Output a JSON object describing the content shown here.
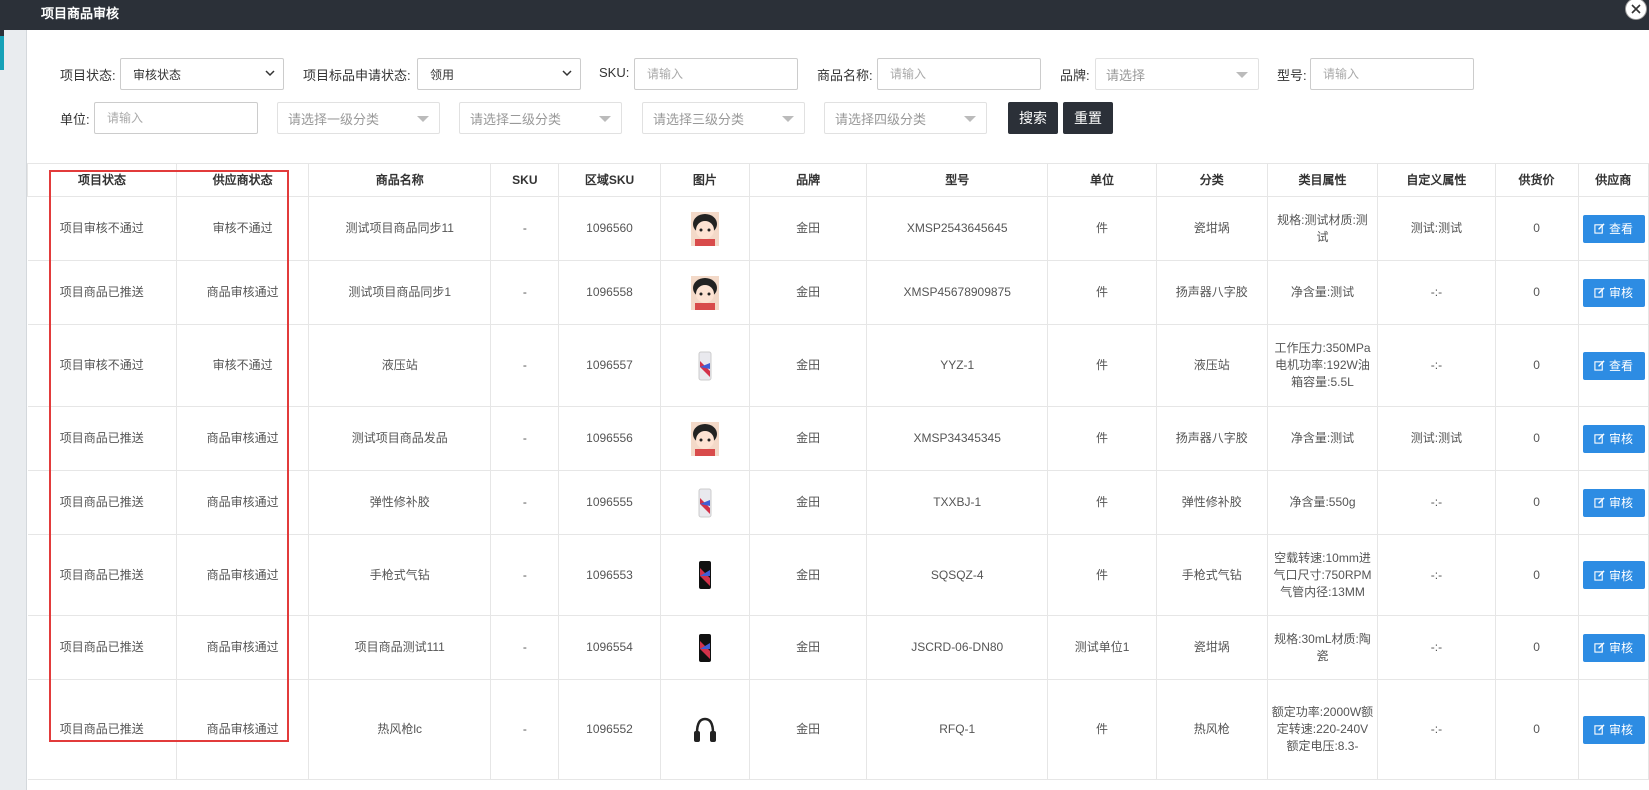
{
  "modal": {
    "title": "项目商品审核",
    "close_icon": "close-icon"
  },
  "filters": {
    "project_status": {
      "label": "项目状态:",
      "value": "审核状态"
    },
    "apply_status": {
      "label": "项目标品申请状态:",
      "value": "领用"
    },
    "sku": {
      "label": "SKU:",
      "placeholder": "请输入"
    },
    "product_name": {
      "label": "商品名称:",
      "placeholder": "请输入"
    },
    "brand": {
      "label": "品牌:",
      "placeholder": "请选择"
    },
    "model": {
      "label": "型号:",
      "placeholder": "请输入"
    },
    "unit": {
      "label": "单位:",
      "placeholder": "请输入"
    },
    "cat1": {
      "placeholder": "请选择一级分类"
    },
    "cat2": {
      "placeholder": "请选择二级分类"
    },
    "cat3": {
      "placeholder": "请选择三级分类"
    },
    "cat4": {
      "placeholder": "请选择四级分类"
    },
    "search_label": "搜索",
    "reset_label": "重置"
  },
  "table": {
    "headers": [
      "项目状态",
      "供应商状态",
      "商品名称",
      "SKU",
      "区域SKU",
      "图片",
      "品牌",
      "型号",
      "单位",
      "分类",
      "类目属性",
      "自定义属性",
      "供货价",
      "供应商"
    ],
    "rows": [
      {
        "status": "项目审核不通过",
        "supplier_status": "审核不通过",
        "name": "测试项目商品同步11",
        "sku": "-",
        "region_sku": "1096560",
        "image": "avatar-girl",
        "brand": "金田",
        "model": "XMSP2543645645",
        "unit": "件",
        "category": "瓷坩埚",
        "attrs": "规格:测试材质:测试",
        "custom": "测试:测试",
        "price": "0",
        "action": "查看"
      },
      {
        "status": "项目商品已推送",
        "supplier_status": "商品审核通过",
        "name": "测试项目商品同步1",
        "sku": "-",
        "region_sku": "1096558",
        "image": "avatar-girl",
        "brand": "金田",
        "model": "XMSP45678909875",
        "unit": "件",
        "category": "扬声器八字胶",
        "attrs": "净含量:测试",
        "custom": "-:-",
        "price": "0",
        "action": "审核"
      },
      {
        "status": "项目审核不通过",
        "supplier_status": "审核不通过",
        "name": "液压站",
        "sku": "-",
        "region_sku": "1096557",
        "image": "phone-white",
        "brand": "金田",
        "model": "YYZ-1",
        "unit": "件",
        "category": "液压站",
        "attrs": "工作压力:350MPa电机功率:192W油箱容量:5.5L",
        "custom": "-:-",
        "price": "0",
        "action": "查看"
      },
      {
        "status": "项目商品已推送",
        "supplier_status": "商品审核通过",
        "name": "测试项目商品发品",
        "sku": "-",
        "region_sku": "1096556",
        "image": "avatar-girl",
        "brand": "金田",
        "model": "XMSP34345345",
        "unit": "件",
        "category": "扬声器八字胶",
        "attrs": "净含量:测试",
        "custom": "测试:测试",
        "price": "0",
        "action": "审核"
      },
      {
        "status": "项目商品已推送",
        "supplier_status": "商品审核通过",
        "name": "弹性修补胶",
        "sku": "-",
        "region_sku": "1096555",
        "image": "phone-white",
        "brand": "金田",
        "model": "TXXBJ-1",
        "unit": "件",
        "category": "弹性修补胶",
        "attrs": "净含量:550g",
        "custom": "-:-",
        "price": "0",
        "action": "审核"
      },
      {
        "status": "项目商品已推送",
        "supplier_status": "商品审核通过",
        "name": "手枪式气钻",
        "sku": "-",
        "region_sku": "1096553",
        "image": "phone-black",
        "brand": "金田",
        "model": "SQSQZ-4",
        "unit": "件",
        "category": "手枪式气钻",
        "attrs": "空载转速:10mm进气口尺寸:750RPM气管内径:13MM",
        "custom": "-:-",
        "price": "0",
        "action": "审核"
      },
      {
        "status": "项目商品已推送",
        "supplier_status": "商品审核通过",
        "name": "项目商品测试111",
        "sku": "-",
        "region_sku": "1096554",
        "image": "phone-black",
        "brand": "金田",
        "model": "JSCRD-06-DN80",
        "unit": "测试单位1",
        "category": "瓷坩埚",
        "attrs": "规格:30mL材质:陶瓷",
        "custom": "-:-",
        "price": "0",
        "action": "审核"
      },
      {
        "status": "项目商品已推送",
        "supplier_status": "商品审核通过",
        "name": "热风枪lc",
        "sku": "-",
        "region_sku": "1096552",
        "image": "headphones",
        "brand": "金田",
        "model": "RFQ-1",
        "unit": "件",
        "category": "热风枪",
        "attrs": "额定功率:2000W额定转速:220-240V额定电压:8.3-",
        "custom": "-:-",
        "price": "0",
        "action": "审核"
      }
    ]
  },
  "colors": {
    "header_bg": "#2b3038",
    "primary_button": "#2d8ce3",
    "highlight_border": "#e23b3b"
  }
}
